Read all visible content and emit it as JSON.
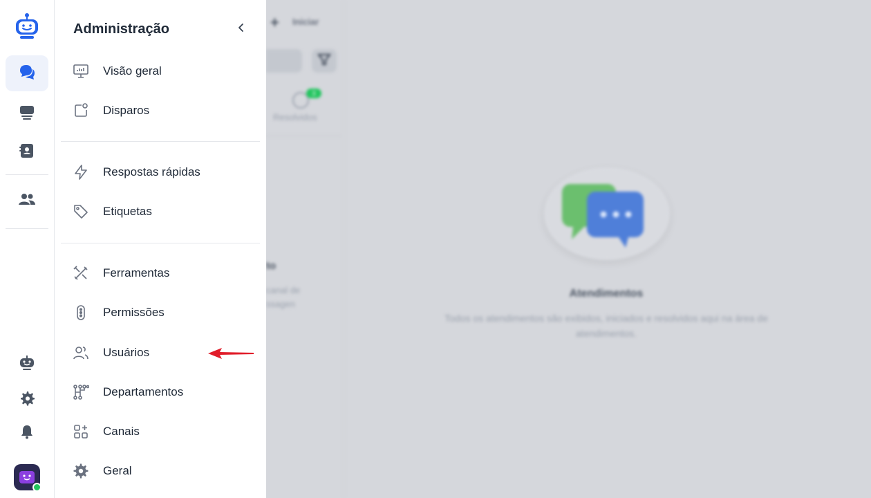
{
  "colors": {
    "accent": "#2563eb",
    "rail_active_bg": "#eef2fb",
    "overlay_bg": "#d5d7dc",
    "status_online": "#22c55e",
    "arrow": "#e11d2a"
  },
  "rail": {
    "items": [
      {
        "name": "chat-icon",
        "active": true
      },
      {
        "name": "monitor-list-icon",
        "active": false
      },
      {
        "name": "contacts-book-icon",
        "active": false
      },
      {
        "name": "users-group-icon",
        "active": false
      }
    ],
    "bottom": [
      "bot-icon",
      "gear-icon",
      "bell-icon"
    ]
  },
  "admin_panel": {
    "title": "Administração",
    "groups": [
      [
        {
          "label": "Visão geral",
          "icon": "presentation-chart-icon"
        },
        {
          "label": "Disparos",
          "icon": "broadcast-icon"
        }
      ],
      [
        {
          "label": "Respostas rápidas",
          "icon": "lightning-icon"
        },
        {
          "label": "Etiquetas",
          "icon": "tag-icon"
        }
      ],
      [
        {
          "label": "Ferramentas",
          "icon": "tools-icon"
        },
        {
          "label": "Permissões",
          "icon": "toggle-dots-icon"
        },
        {
          "label": "Usuários",
          "icon": "users-icon"
        },
        {
          "label": "Departamentos",
          "icon": "hierarchy-icon"
        },
        {
          "label": "Canais",
          "icon": "grid-add-icon"
        },
        {
          "label": "Geral",
          "icon": "settings-icon"
        }
      ]
    ]
  },
  "background": {
    "start_label": "Iniciar",
    "resolved_label": "Resolvidos",
    "resolved_badge": "3",
    "frag_title": "to",
    "frag_desc_line1": "canal de",
    "frag_desc_line2": "ssagen",
    "empty_title": "Atendimentos",
    "empty_desc": "Todos os atendimentos são exibidos, iniciados e resolvidos aqui na área de atendimentos."
  }
}
